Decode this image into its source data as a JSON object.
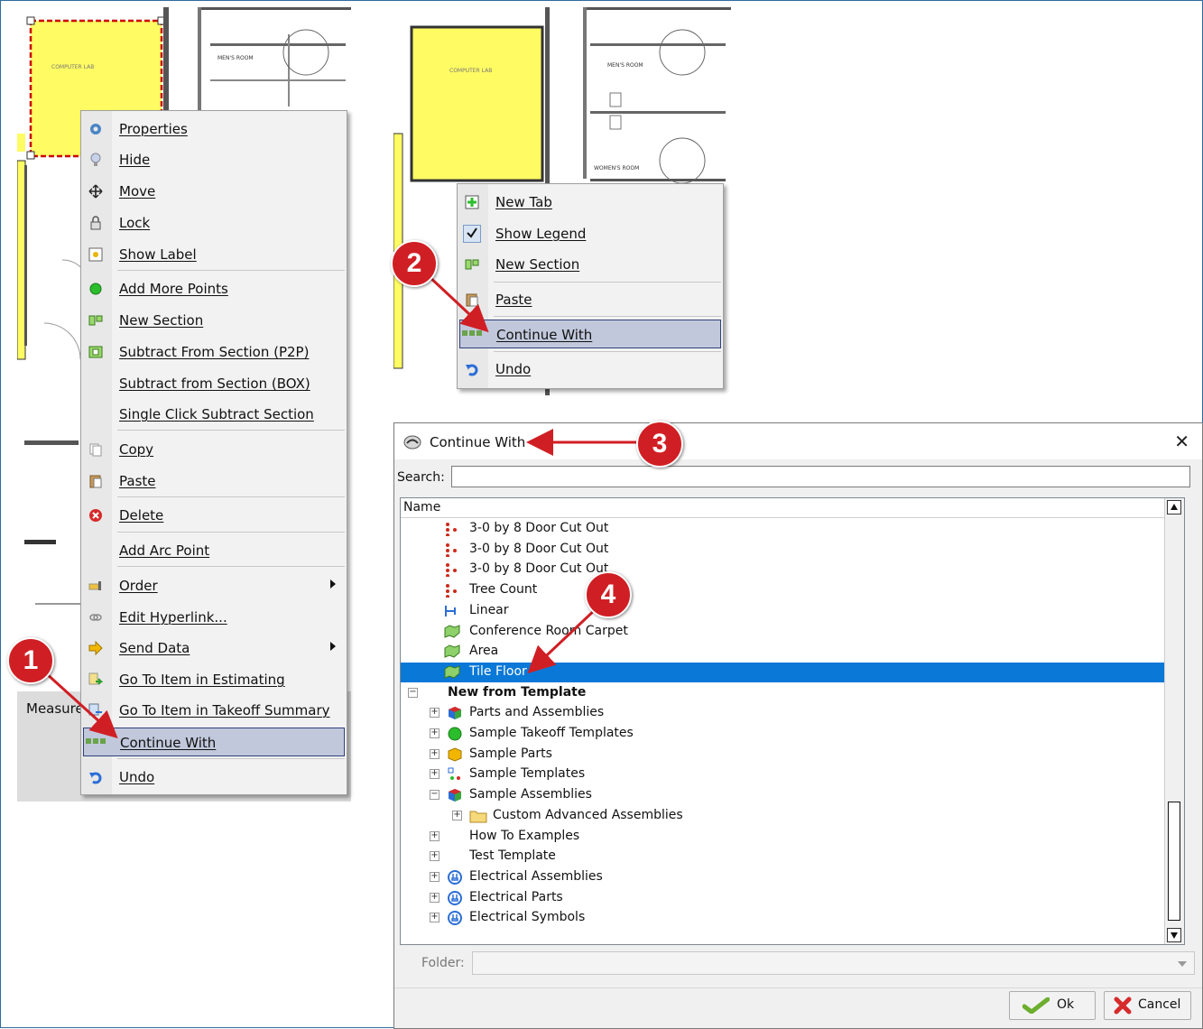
{
  "left_menu": {
    "items": [
      {
        "label": "Properties",
        "icon": "gear-icon"
      },
      {
        "label": "Hide",
        "icon": "lightbulb-icon"
      },
      {
        "label": "Move",
        "icon": "move-arrows-icon"
      },
      {
        "label": "Lock",
        "icon": "padlock-icon"
      },
      {
        "label": "Show Label",
        "icon": "label-icon"
      },
      {
        "label": "Add More Points",
        "icon": "green-dot-icon"
      },
      {
        "label": "New Section",
        "icon": "new-section-icon"
      },
      {
        "label": "Subtract From Section (P2P)",
        "icon": "subtract-section-icon"
      },
      {
        "label": "Subtract from Section (BOX)",
        "icon": ""
      },
      {
        "label": "Single Click Subtract Section",
        "icon": ""
      },
      {
        "label": "Copy",
        "icon": "copy-icon"
      },
      {
        "label": "Paste",
        "icon": "paste-icon"
      },
      {
        "label": "Delete",
        "icon": "delete-icon"
      },
      {
        "label": "Add Arc Point",
        "icon": ""
      },
      {
        "label": "Order",
        "icon": "order-icon"
      },
      {
        "label": "Edit Hyperlink...",
        "icon": "hyperlink-icon"
      },
      {
        "label": "Send Data",
        "icon": "send-arrow-icon"
      },
      {
        "label": "Go To Item in Estimating",
        "icon": "goto-estimating-icon"
      },
      {
        "label": "Go To Item in Takeoff Summary",
        "icon": "goto-summary-icon"
      },
      {
        "label": "Continue With",
        "icon": "continue-with-icon"
      },
      {
        "label": "Undo",
        "icon": "undo-icon"
      }
    ]
  },
  "plan": {
    "room1": "COMPUTER LAB",
    "room2": "MEN'S ROOM",
    "room3": "WOMEN'S ROOM",
    "tab_label": "Measure"
  },
  "right_menu": {
    "items": [
      {
        "label": "New Tab"
      },
      {
        "label": "Show Legend"
      },
      {
        "label": "New Section"
      },
      {
        "label": "Paste"
      },
      {
        "label": "Continue With"
      },
      {
        "label": "Undo"
      }
    ]
  },
  "callouts": [
    "1",
    "2",
    "3",
    "4"
  ],
  "dialog": {
    "title": "Continue With",
    "search_label": "Search:",
    "search_value": "",
    "column_header": "Name",
    "folder_label": "Folder:",
    "ok_label": "Ok",
    "cancel_label": "Cancel",
    "tree": [
      {
        "label": "3-0 by 8 Door Cut Out",
        "icon": "red-dots-icon",
        "bold": false
      },
      {
        "label": "3-0 by 8 Door Cut Out",
        "icon": "red-dots-icon",
        "bold": false
      },
      {
        "label": "3-0 by 8 Door Cut Out",
        "icon": "red-dots-icon",
        "bold": false
      },
      {
        "label": "Tree Count",
        "icon": "red-dots-icon",
        "bold": false
      },
      {
        "label": "Linear",
        "icon": "linear-icon",
        "bold": false
      },
      {
        "label": "Conference Room Carpet",
        "icon": "area-icon",
        "bold": false
      },
      {
        "label": "Area",
        "icon": "area-icon",
        "bold": false
      },
      {
        "label": "Tile Floor",
        "icon": "area-icon",
        "bold": false,
        "selected": true
      },
      {
        "label": "New from Template",
        "icon": "",
        "bold": true
      },
      {
        "label": "Parts and Assemblies",
        "icon": "cube-icon",
        "bold": false
      },
      {
        "label": "Sample Takeoff Templates",
        "icon": "green-dot-icon",
        "bold": false
      },
      {
        "label": "Sample Parts",
        "icon": "yellow-cube-icon",
        "bold": false
      },
      {
        "label": "Sample Templates",
        "icon": "template-icon",
        "bold": false
      },
      {
        "label": "Sample Assemblies",
        "icon": "cube-icon",
        "bold": false
      },
      {
        "label": "Custom Advanced Assemblies",
        "icon": "folder-icon",
        "bold": false
      },
      {
        "label": "How To Examples",
        "icon": "",
        "bold": false
      },
      {
        "label": "Test Template",
        "icon": "",
        "bold": false
      },
      {
        "label": "Electrical Assemblies",
        "icon": "electrical-icon",
        "bold": false
      },
      {
        "label": "Electrical Parts",
        "icon": "electrical-icon",
        "bold": false
      },
      {
        "label": "Electrical Symbols",
        "icon": "electrical-icon",
        "bold": false
      }
    ]
  }
}
